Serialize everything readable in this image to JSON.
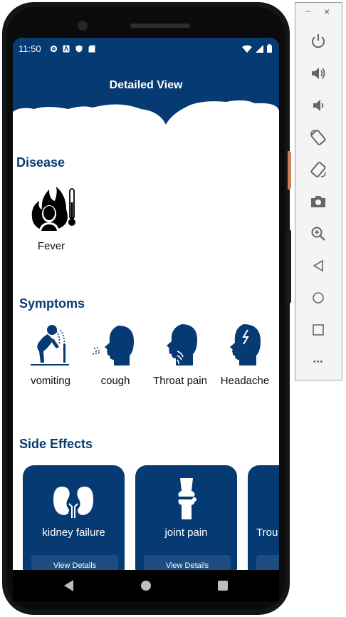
{
  "status_bar": {
    "time": "11:50"
  },
  "header": {
    "title": "Detailed View"
  },
  "disease": {
    "section_title": "Disease",
    "items": [
      {
        "label": "Fever",
        "icon": "fever-icon"
      }
    ]
  },
  "symptoms": {
    "section_title": "Symptoms",
    "items": [
      {
        "label": "vomiting",
        "icon": "vomiting-icon"
      },
      {
        "label": "cough",
        "icon": "cough-icon"
      },
      {
        "label": "Throat pain",
        "icon": "throat-pain-icon"
      },
      {
        "label": "Headache",
        "icon": "headache-icon"
      }
    ]
  },
  "side_effects": {
    "section_title": "Side Effects",
    "cards": [
      {
        "title": "kidney failure",
        "button": "View Details",
        "icon": "kidney-icon"
      },
      {
        "title": "joint pain",
        "button": "View Details",
        "icon": "knee-joint-icon"
      },
      {
        "title": "Trou",
        "button": "",
        "icon": ""
      }
    ]
  },
  "emulator_toolbar": {
    "minimize": "–",
    "close": "×",
    "more": "•••",
    "tools": [
      "power-icon",
      "volume-up-icon",
      "volume-down-icon",
      "rotate-left-icon",
      "rotate-right-icon",
      "camera-icon",
      "zoom-icon",
      "back-icon",
      "home-icon",
      "overview-icon"
    ]
  },
  "colors": {
    "primary": "#063a73",
    "accent_text": "#0a3c72",
    "background": "#ffffff"
  }
}
